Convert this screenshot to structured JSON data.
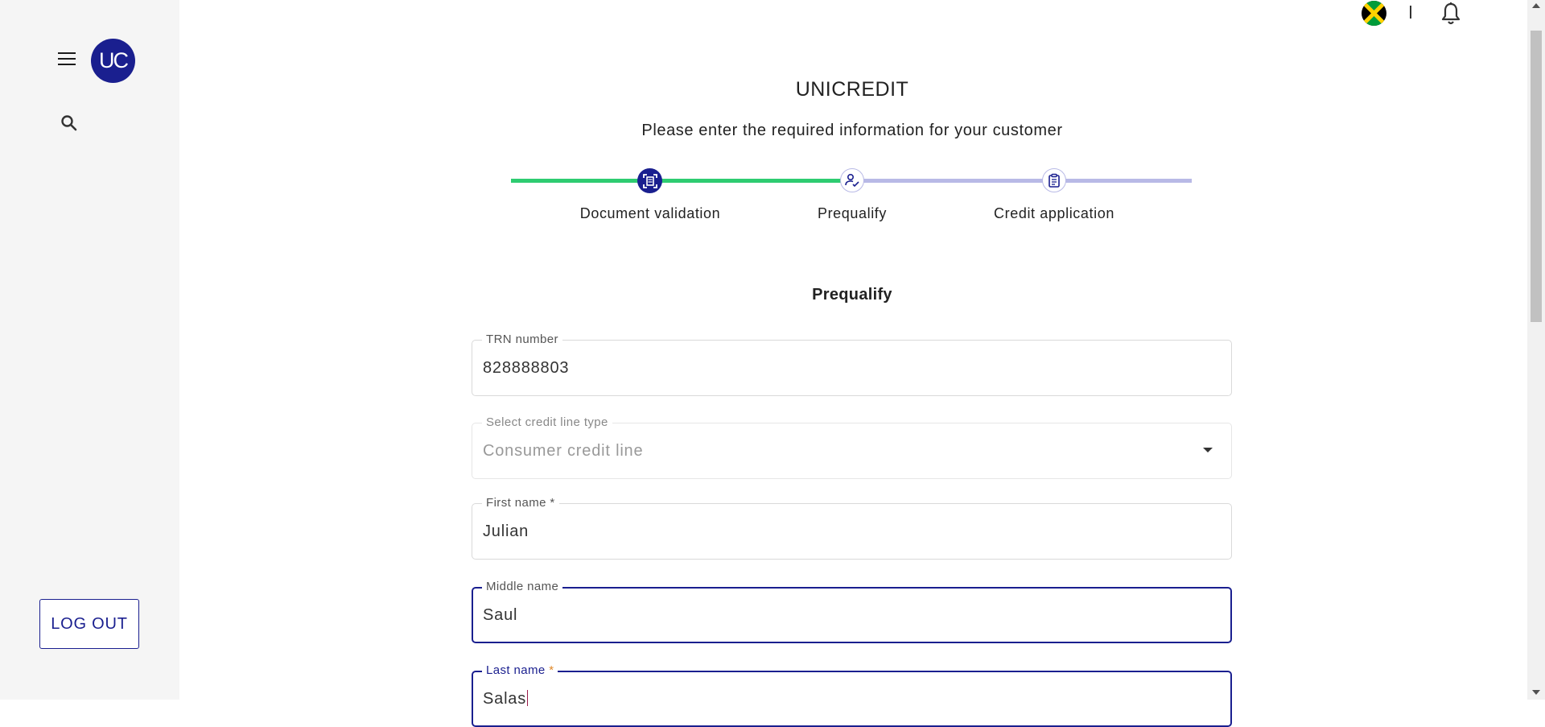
{
  "sidebar": {
    "logo_text": "UC",
    "menu_icon": "hamburger-menu-icon",
    "search_icon": "search-icon",
    "logout_label": "LOG OUT"
  },
  "topbar": {
    "flag_icon": "jamaica-flag-icon",
    "separator": "|",
    "bell_icon": "bell-icon"
  },
  "header": {
    "title": "UNICREDIT",
    "subtitle": "Please enter the required information for your customer"
  },
  "stepper": {
    "steps": [
      {
        "label": "Document validation",
        "icon": "document-scan-icon",
        "state": "completed"
      },
      {
        "label": "Prequalify",
        "icon": "user-check-icon",
        "state": "active"
      },
      {
        "label": "Credit application",
        "icon": "clipboard-icon",
        "state": "pending"
      }
    ],
    "colors": {
      "completed": "#2ecc71",
      "pending": "#b8b9e6",
      "accent": "#1a1f8f"
    }
  },
  "form": {
    "section_title": "Prequalify",
    "fields": [
      {
        "label": "TRN number",
        "value": "828888803",
        "required": false,
        "state": "filled"
      },
      {
        "label": "Select credit line type",
        "value": "Consumer credit line",
        "required": false,
        "state": "disabled"
      },
      {
        "label": "First name",
        "value": "Julian",
        "required": true,
        "state": "filled"
      },
      {
        "label": "Middle name",
        "value": "Saul",
        "required": false,
        "state": "focused"
      },
      {
        "label": "Last name",
        "value": "Salas",
        "required": true,
        "state": "focused"
      }
    ]
  }
}
